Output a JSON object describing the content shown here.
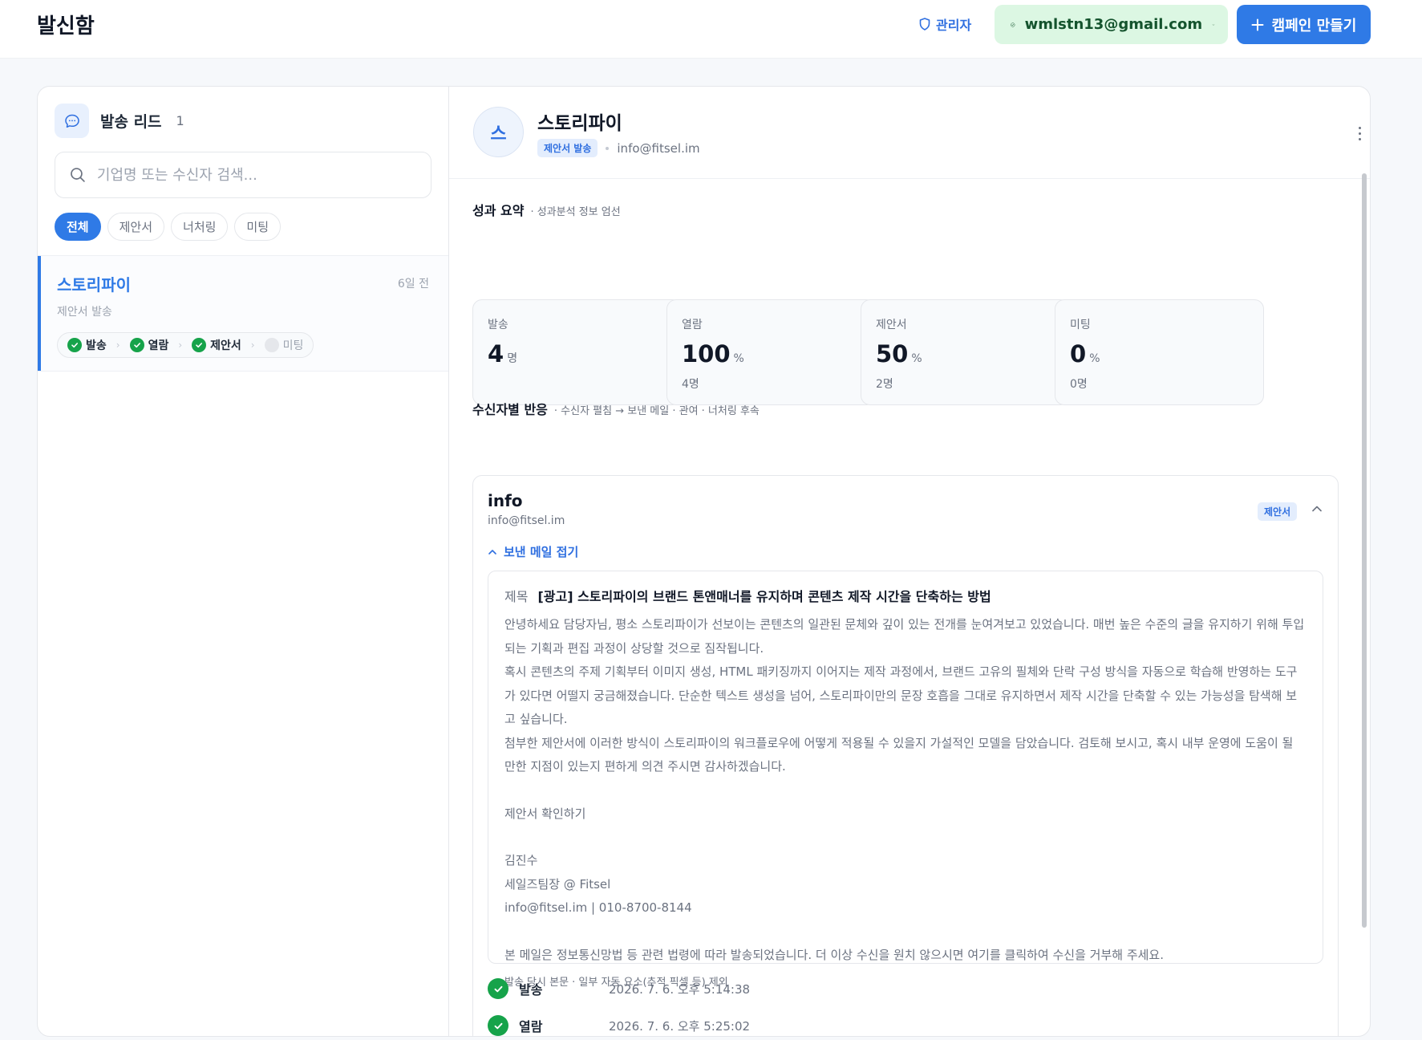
{
  "header": {
    "title": "발신함",
    "admin_label": "관리자",
    "account_email": "wmlstn13@gmail.com",
    "create_label": "캠페인 만들기"
  },
  "sidebar": {
    "title": "발송 리드",
    "count": "1",
    "search_placeholder": "기업명 또는 수신자 검색...",
    "filters": [
      "전체",
      "제안서",
      "너처링",
      "미팅"
    ],
    "leads": [
      {
        "name": "스토리파이",
        "time": "6일 전",
        "status": "제안서 발송",
        "steps": [
          {
            "label": "발송",
            "done": true
          },
          {
            "label": "열람",
            "done": true
          },
          {
            "label": "제안서",
            "done": true
          },
          {
            "label": "미팅",
            "done": false
          }
        ]
      }
    ]
  },
  "detail": {
    "avatar_letter": "스",
    "company": "스토리파이",
    "badge": "제안서 발송",
    "email": "info@fitsel.im",
    "summary": {
      "title": "성과 요약",
      "subtitle": "· 성과분석 정보 엄선",
      "stats": [
        {
          "label": "발송",
          "value": "4",
          "unit": "명",
          "sub": ""
        },
        {
          "label": "열람",
          "value": "100",
          "unit": "%",
          "sub": "4명"
        },
        {
          "label": "제안서",
          "value": "50",
          "unit": "%",
          "sub": "2명"
        },
        {
          "label": "미팅",
          "value": "0",
          "unit": "%",
          "sub": "0명"
        }
      ]
    },
    "recipients": {
      "title": "수신자별 반응",
      "subtitle": "· 수신자 펼침 → 보낸 메일 · 관여 · 너처링 후속",
      "items": [
        {
          "name": "info",
          "email": "info@fitsel.im",
          "badge": "제안서",
          "fold_label": "보낸 메일 접기",
          "mail": {
            "subject_key": "제목",
            "subject": "[광고] 스토리파이의 브랜드 톤앤매너를 유지하며 콘텐츠 제작 시간을 단축하는 방법",
            "p1": "안녕하세요 담당자님, 평소 스토리파이가 선보이는 콘텐츠의 일관된 문체와 깊이 있는 전개를 눈여겨보고 있었습니다. 매번 높은 수준의 글을 유지하기 위해 투입되는 기획과 편집 과정이 상당할 것으로 짐작됩니다.",
            "p2": "혹시 콘텐츠의 주제 기획부터 이미지 생성, HTML 패키징까지 이어지는 제작 과정에서, 브랜드 고유의 필체와 단락 구성 방식을 자동으로 학습해 반영하는 도구가 있다면 어떨지 궁금해졌습니다. 단순한 텍스트 생성을 넘어, 스토리파이만의 문장 호흡을 그대로 유지하면서 제작 시간을 단축할 수 있는 가능성을 탐색해 보고 싶습니다.",
            "p3": "첨부한 제안서에 이러한 방식이 스토리파이의 워크플로우에 어떻게 적용될 수 있을지 가설적인 모델을 담았습니다. 검토해 보시고, 혹시 내부 운영에 도움이 될 만한 지점이 있는지 편하게 의견 주시면 감사하겠습니다.",
            "link": "제안서 확인하기",
            "sig_name": "김진수",
            "sig_title": "세일즈팀장 @ Fitsel",
            "sig_contact": "info@fitsel.im | 010-8700-8144",
            "footer": "본 메일은 정보통신망법 등 관련 법령에 따라 발송되었습니다. 더 이상 수신을 원치 않으시면 여기를 클릭하여 수신을 거부해 주세요.",
            "note": "발송 당시 본문 · 일부 자동 요소(추적 픽셀 등) 제외"
          },
          "timeline": [
            {
              "label": "발송",
              "time": "2026. 7. 6. 오후 5:14:38"
            },
            {
              "label": "열람",
              "time": "2026. 7. 6. 오후 5:25:02"
            }
          ]
        }
      ]
    }
  },
  "colors": {
    "accent": "#2f7ae6",
    "success": "#16a34a",
    "account_bg": "#dcf7e3"
  }
}
